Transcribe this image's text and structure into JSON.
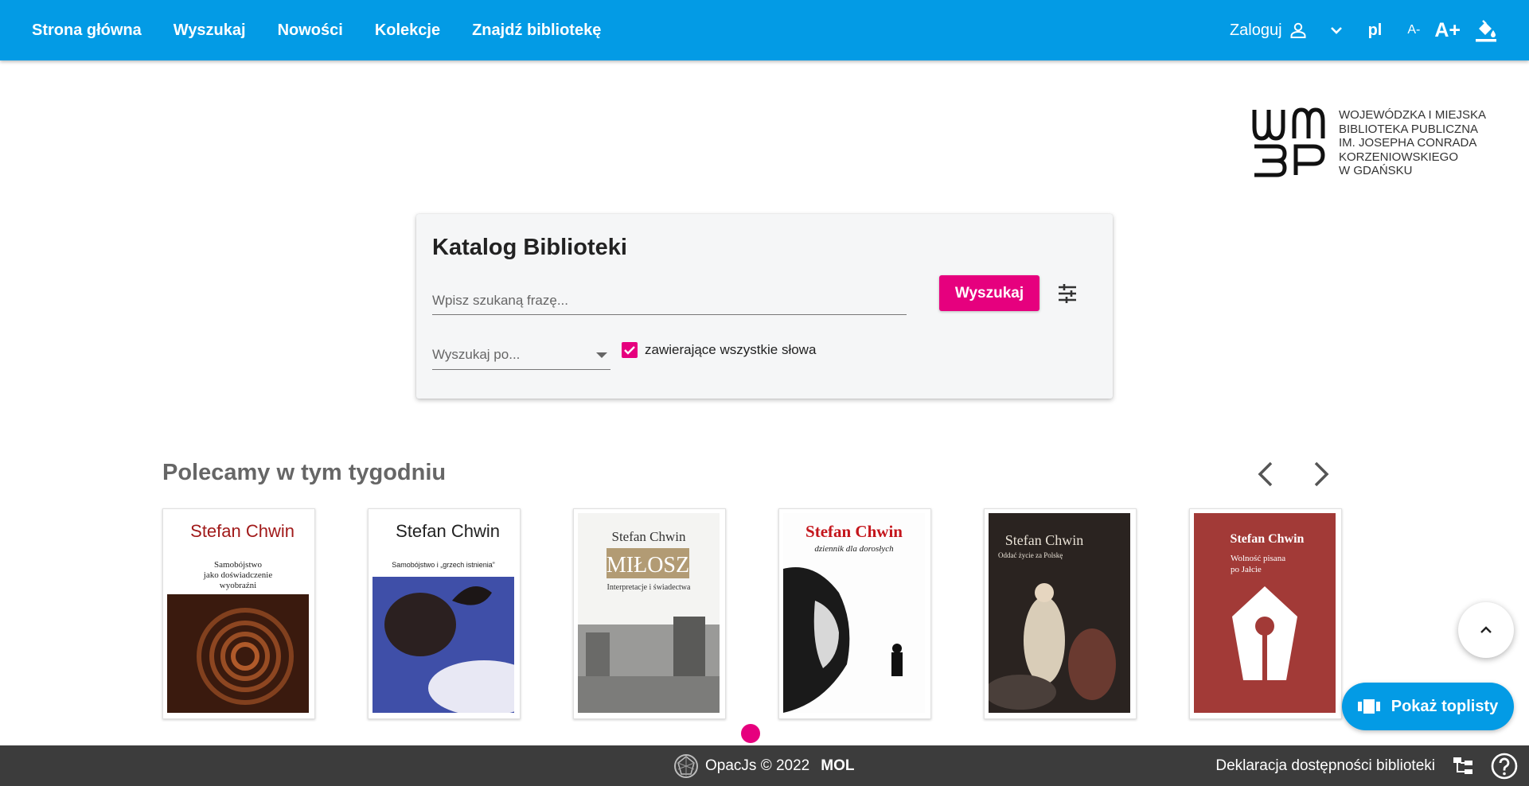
{
  "nav": {
    "items": [
      "Strona główna",
      "Wyszukaj",
      "Nowości",
      "Kolekcje",
      "Znajdź bibliotekę"
    ],
    "login_label": "Zaloguj",
    "lang": "pl",
    "font_smaller": "A-",
    "font_larger": "A+"
  },
  "logo": {
    "lines": [
      "Wojewódzka i Miejska",
      "Biblioteka Publiczna",
      "im. Josepha Conrada",
      "Korzeniowskiego",
      "w Gdańsku"
    ]
  },
  "search": {
    "title": "Katalog Biblioteki",
    "placeholder": "Wpisz szukaną frazę...",
    "button_label": "Wyszukaj",
    "search_by_label": "Wyszukaj po...",
    "checkbox_label": "zawierające wszystkie słowa",
    "checkbox_checked": true
  },
  "recommendations": {
    "title": "Polecamy w tym tygodniu",
    "books": [
      {
        "author": "Stefan Chwin",
        "title_line1": "Samobójstwo",
        "title_line2": "jako doświadczenie",
        "title_line3": "wyobraźni"
      },
      {
        "author": "Stefan Chwin",
        "title_line1": "Samobójstwo i „grzech istnienia”"
      },
      {
        "author": "Stefan Chwin",
        "title_line1": "MIŁOSZ",
        "title_line2": "Interpretacje i świadectwa"
      },
      {
        "author": "Stefan Chwin",
        "title_line1": "dziennik dla dorosłych"
      },
      {
        "author": "Stefan Chwin",
        "title_line1": "Oddać życie za Polskę"
      },
      {
        "author": "Stefan Chwin",
        "title_line1": "Wolność pisana",
        "title_line2": "po Jałcie"
      }
    ]
  },
  "toplist_button": "Pokaż toplisty",
  "footer": {
    "copyright": "OpacJs © 2022",
    "brand": "MOL",
    "accessibility": "Deklaracja dostępności biblioteki"
  },
  "colors": {
    "primary": "#039be5",
    "accent": "#e6007e",
    "footer": "#3c3c3c"
  }
}
